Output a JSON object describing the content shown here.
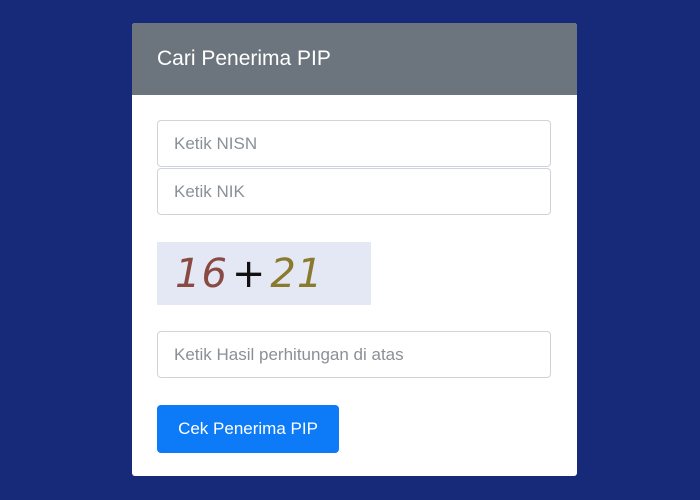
{
  "card": {
    "title": "Cari Penerima PIP"
  },
  "form": {
    "nisn_placeholder": "Ketik NISN",
    "nisn_value": "",
    "nik_placeholder": "Ketik NIK",
    "nik_value": "",
    "captcha": {
      "operand_a": "16",
      "operator": "+",
      "operand_b": "21"
    },
    "hasil_placeholder": "Ketik Hasil perhitungan di atas",
    "hasil_value": "",
    "submit_label": "Cek Penerima PIP"
  },
  "colors": {
    "page_background": "#172a7a",
    "header_background": "#6c757d",
    "button_background": "#0d7af7"
  }
}
